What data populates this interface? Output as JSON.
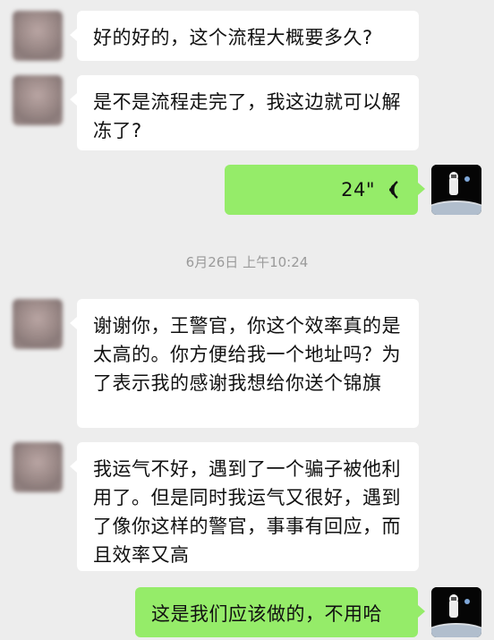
{
  "messages": [
    {
      "side": "left",
      "text": "好的好的，这个流程大概要多久?"
    },
    {
      "side": "left",
      "text": "是不是流程走完了，我这边就可以解冻了?"
    },
    {
      "side": "right",
      "type": "voice",
      "duration": "24\"",
      "icon": "voice-wave-icon"
    },
    {
      "side": "left",
      "text": "谢谢你，王警官，你这个效率真的是太高的。你方便给我一个地址吗？为了表示我的感谢我想给你送个锦旗"
    },
    {
      "side": "left",
      "text": "我运气不好，遇到了一个骗子被他利用了。但是同时我运气又很好，遇到了像你这样的警官，事事有回应，而且效率又高"
    },
    {
      "side": "right",
      "text": "这是我们应该做的，不用哈"
    }
  ],
  "timestamp": "6月26日 上午10:24",
  "colors": {
    "background": "#ededed",
    "bubble_self": "#95ec69",
    "bubble_other": "#ffffff"
  }
}
